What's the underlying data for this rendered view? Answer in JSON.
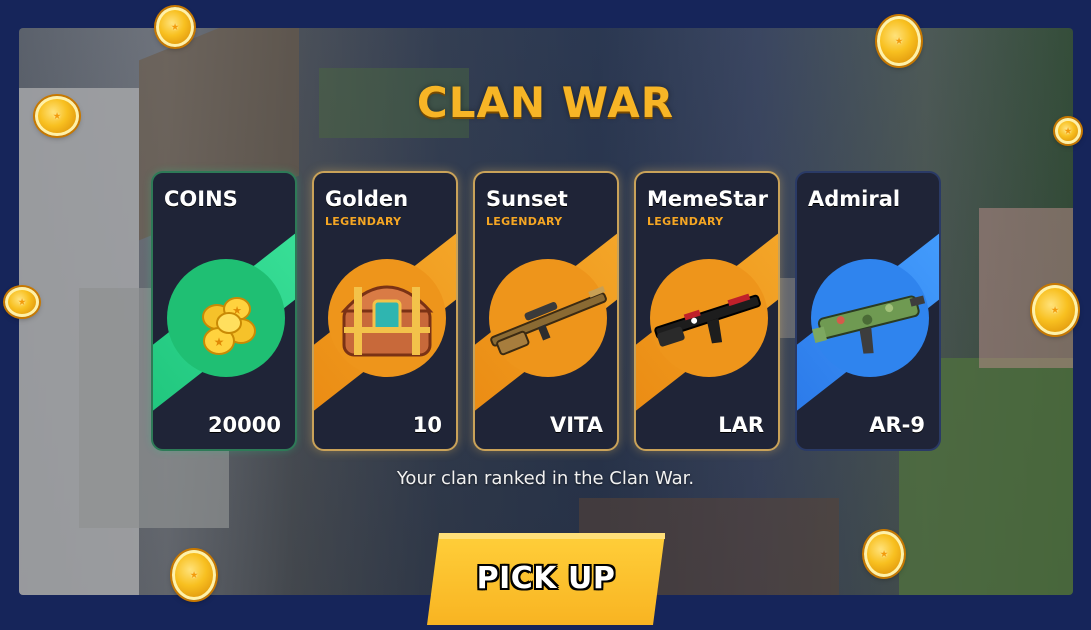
{
  "screen": {
    "title": "CLAN WAR",
    "message": "Your clan ranked in the Clan War."
  },
  "rewards": [
    {
      "name": "COINS",
      "rarity": "",
      "amount": "20000",
      "theme": "green",
      "icon": "coins-pile-icon"
    },
    {
      "name": "Golden",
      "rarity": "LEGENDARY",
      "amount": "10",
      "theme": "orange",
      "icon": "treasure-chest-icon"
    },
    {
      "name": "Sunset",
      "rarity": "LEGENDARY",
      "amount": "VITA",
      "theme": "orange",
      "icon": "sniper-rifle-icon"
    },
    {
      "name": "MemeStar",
      "rarity": "LEGENDARY",
      "amount": "LAR",
      "theme": "orange",
      "icon": "assault-rifle-icon"
    },
    {
      "name": "Admiral",
      "rarity": "",
      "amount": "AR-9",
      "theme": "blue",
      "icon": "camo-smg-icon"
    }
  ],
  "button": {
    "label": "PICK UP"
  },
  "colors": {
    "title": "#f7b526",
    "legendary": "#f5a623",
    "green": "#1fbf73",
    "orange": "#ee951b",
    "blue": "#2f84ee",
    "button": "#f8b422"
  }
}
